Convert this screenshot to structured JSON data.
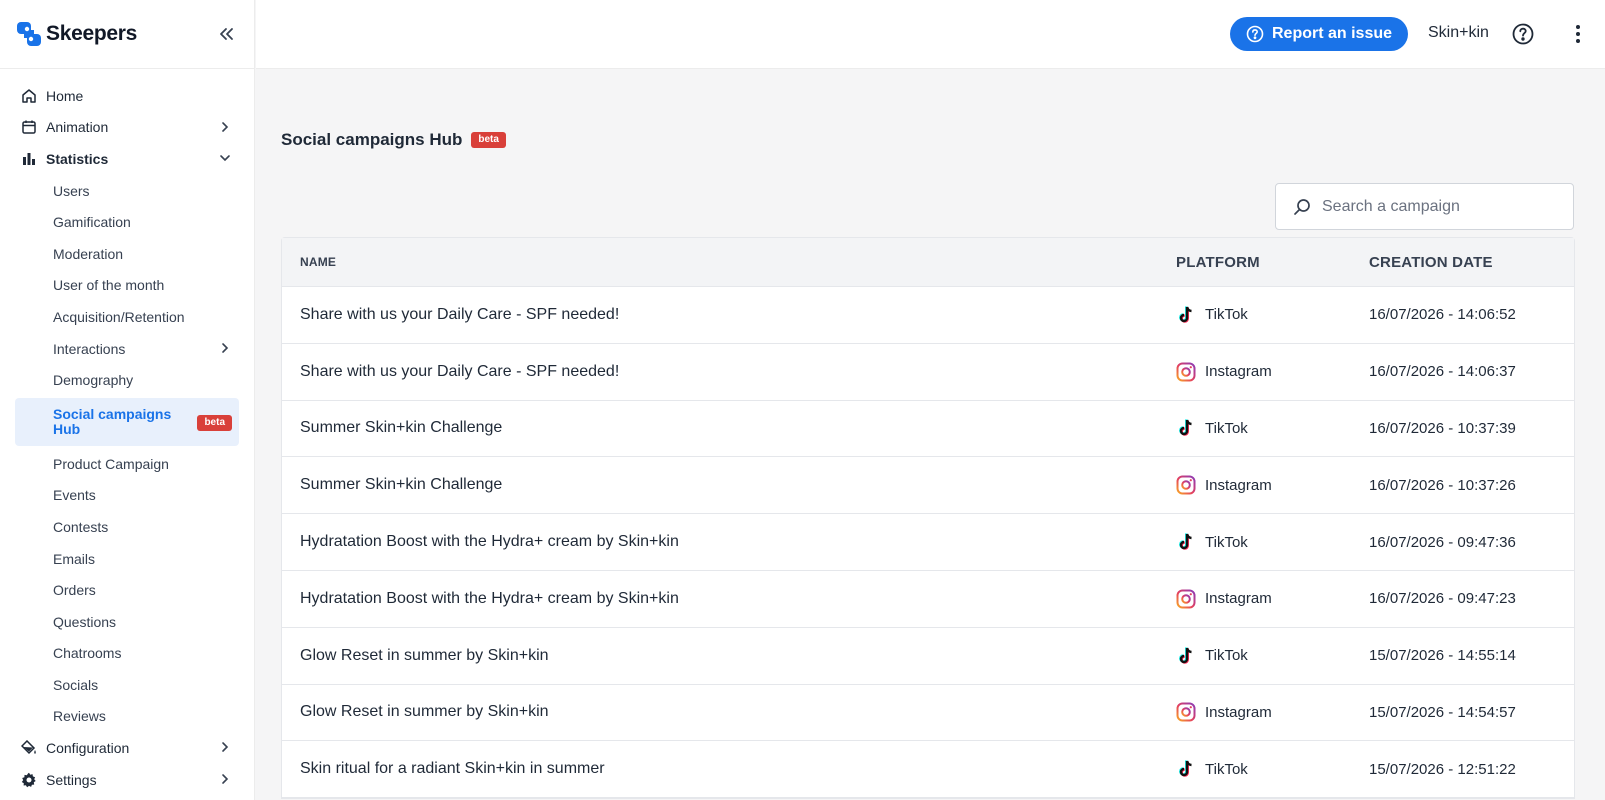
{
  "brand": {
    "name": "Skeepers",
    "accent": "#1a73e8"
  },
  "sidebar": {
    "top_items": [
      {
        "label": "Home",
        "icon": "home-icon"
      },
      {
        "label": "Animation",
        "icon": "calendar-icon"
      },
      {
        "label": "Statistics",
        "icon": "bar-chart-icon"
      }
    ],
    "statistics_items": [
      {
        "label": "Users"
      },
      {
        "label": "Gamification"
      },
      {
        "label": "Moderation"
      },
      {
        "label": "User of the month"
      },
      {
        "label": "Acquisition/Retention"
      },
      {
        "label": "Interactions"
      },
      {
        "label": "Demography"
      },
      {
        "label": "Social campaigns Hub",
        "badge": "beta"
      },
      {
        "label": "Product Campaign"
      },
      {
        "label": "Events"
      },
      {
        "label": "Contests"
      },
      {
        "label": "Emails"
      },
      {
        "label": "Orders"
      },
      {
        "label": "Questions"
      },
      {
        "label": "Chatrooms"
      },
      {
        "label": "Socials"
      },
      {
        "label": "Reviews"
      }
    ],
    "bottom_items": [
      {
        "label": "Configuration",
        "icon": "paint-bucket-icon"
      },
      {
        "label": "Settings",
        "icon": "gear-icon"
      }
    ]
  },
  "topbar": {
    "report_label": "Report an issue",
    "account_name": "Skin+kin"
  },
  "page": {
    "title": "Social campaigns Hub",
    "badge": "beta",
    "search_placeholder": "Search a campaign"
  },
  "table": {
    "headers": {
      "name": "Name",
      "platform": "Platform",
      "date": "Creation date"
    },
    "rows": [
      {
        "name": "Share with us your Daily Care - SPF needed!",
        "platform": "TikTok",
        "date": "16/07/2026 - 14:06:52"
      },
      {
        "name": "Share with us your Daily Care - SPF needed!",
        "platform": "Instagram",
        "date": "16/07/2026 - 14:06:37"
      },
      {
        "name": "Summer Skin+kin Challenge",
        "platform": "TikTok",
        "date": "16/07/2026 - 10:37:39"
      },
      {
        "name": "Summer Skin+kin Challenge",
        "platform": "Instagram",
        "date": "16/07/2026 - 10:37:26"
      },
      {
        "name": "Hydratation Boost with the Hydra+ cream by Skin+kin",
        "platform": "TikTok",
        "date": "16/07/2026 - 09:47:36"
      },
      {
        "name": "Hydratation Boost with the Hydra+ cream by Skin+kin",
        "platform": "Instagram",
        "date": "16/07/2026 - 09:47:23"
      },
      {
        "name": "Glow Reset in summer by Skin+kin",
        "platform": "TikTok",
        "date": "15/07/2026 - 14:55:14"
      },
      {
        "name": "Glow Reset in summer by Skin+kin",
        "platform": "Instagram",
        "date": "15/07/2026 - 14:54:57"
      },
      {
        "name": "Skin ritual for a radiant Skin+kin in summer",
        "platform": "TikTok",
        "date": "15/07/2026 - 12:51:22"
      }
    ]
  }
}
